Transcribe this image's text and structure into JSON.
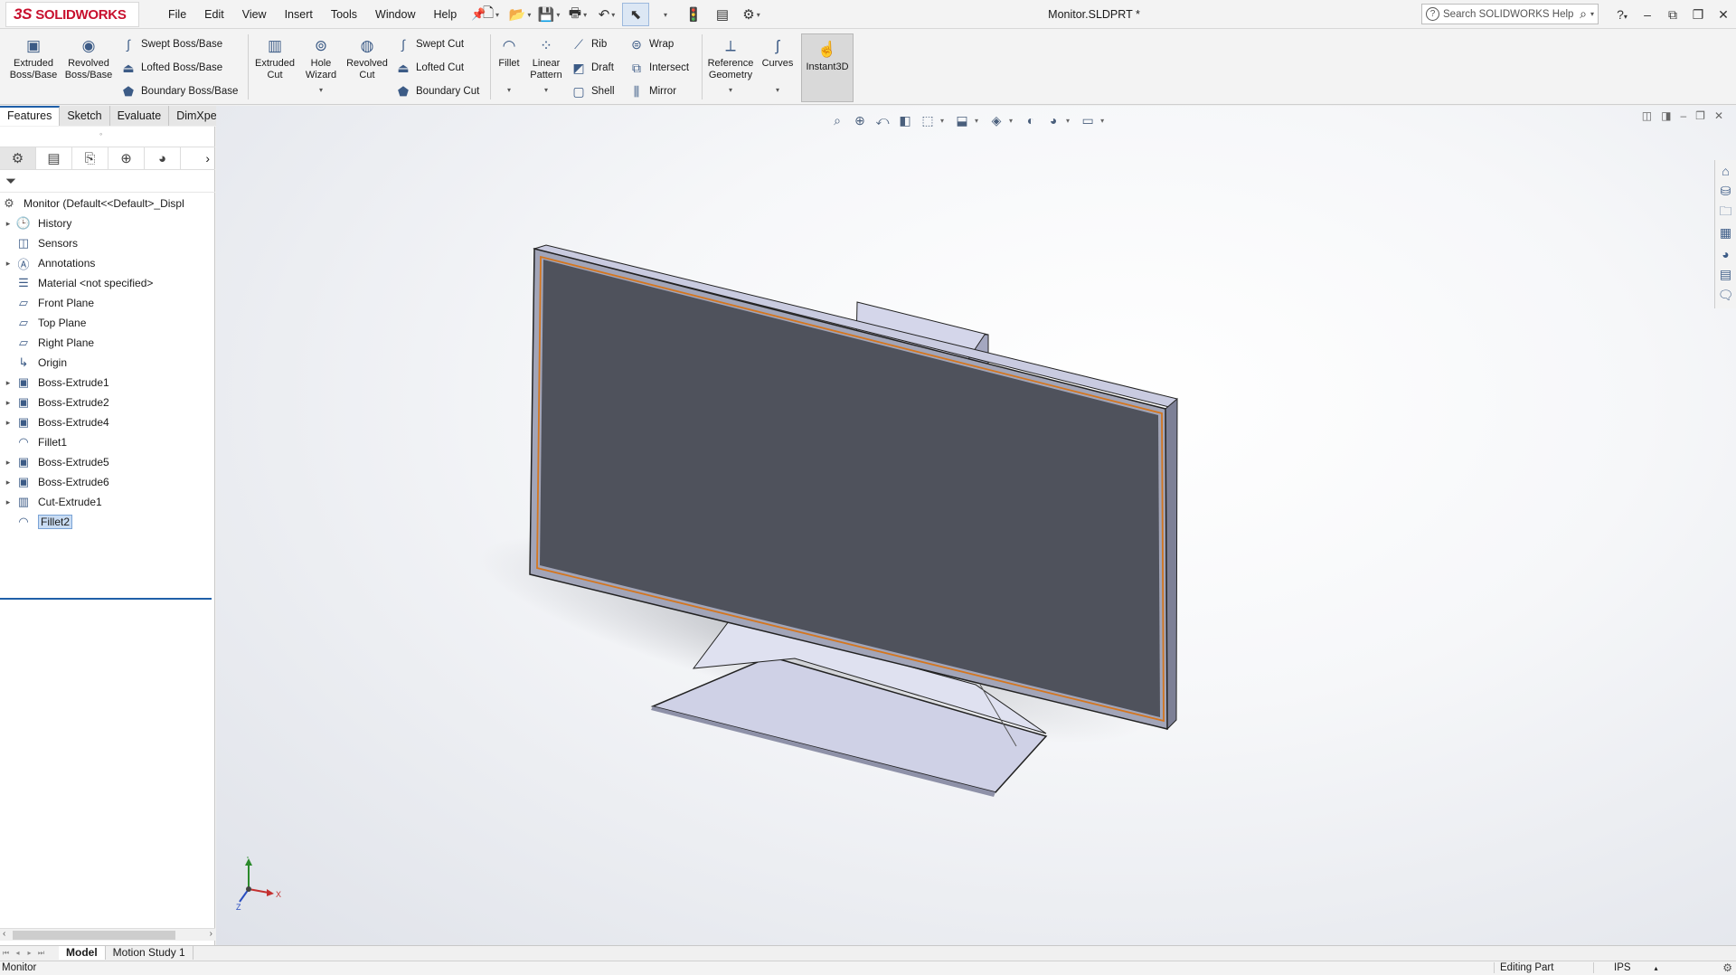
{
  "app": {
    "logo_text": "SOLIDWORKS",
    "logo_mark": "3S",
    "document_title": "Monitor.SLDPRT *",
    "menu": [
      "File",
      "Edit",
      "View",
      "Insert",
      "Tools",
      "Window",
      "Help"
    ],
    "search_placeholder": "Search SOLIDWORKS Help"
  },
  "ribbon": {
    "extruded_boss": "Extruded\nBoss/Base",
    "revolved_boss": "Revolved\nBoss/Base",
    "swept_boss": "Swept Boss/Base",
    "lofted_boss": "Lofted Boss/Base",
    "boundary_boss": "Boundary Boss/Base",
    "extruded_cut": "Extruded\nCut",
    "hole_wizard": "Hole\nWizard",
    "revolved_cut": "Revolved\nCut",
    "swept_cut": "Swept Cut",
    "lofted_cut": "Lofted Cut",
    "boundary_cut": "Boundary Cut",
    "fillet": "Fillet",
    "linear_pattern": "Linear\nPattern",
    "rib": "Rib",
    "draft": "Draft",
    "shell": "Shell",
    "wrap": "Wrap",
    "intersect": "Intersect",
    "mirror": "Mirror",
    "reference_geometry": "Reference\nGeometry",
    "curves": "Curves",
    "instant3d": "Instant3D"
  },
  "command_tabs": [
    "Features",
    "Sketch",
    "Evaluate",
    "DimXpert"
  ],
  "feature_tree": {
    "root": "Monitor  (Default<<Default>_Displ",
    "items": [
      {
        "label": "History",
        "expandable": true,
        "icon": "history-icon"
      },
      {
        "label": "Sensors",
        "expandable": false,
        "icon": "sensors-icon"
      },
      {
        "label": "Annotations",
        "expandable": true,
        "icon": "annotations-icon"
      },
      {
        "label": "Material <not specified>",
        "expandable": false,
        "icon": "material-icon"
      },
      {
        "label": "Front Plane",
        "expandable": false,
        "icon": "plane-icon"
      },
      {
        "label": "Top Plane",
        "expandable": false,
        "icon": "plane-icon"
      },
      {
        "label": "Right Plane",
        "expandable": false,
        "icon": "plane-icon"
      },
      {
        "label": "Origin",
        "expandable": false,
        "icon": "origin-icon"
      },
      {
        "label": "Boss-Extrude1",
        "expandable": true,
        "icon": "extrude-icon"
      },
      {
        "label": "Boss-Extrude2",
        "expandable": true,
        "icon": "extrude-icon"
      },
      {
        "label": "Boss-Extrude4",
        "expandable": true,
        "icon": "extrude-icon"
      },
      {
        "label": "Fillet1",
        "expandable": false,
        "icon": "fillet-icon"
      },
      {
        "label": "Boss-Extrude5",
        "expandable": true,
        "icon": "extrude-icon"
      },
      {
        "label": "Boss-Extrude6",
        "expandable": true,
        "icon": "extrude-icon"
      },
      {
        "label": "Cut-Extrude1",
        "expandable": true,
        "icon": "cut-extrude-icon"
      },
      {
        "label": "Fillet2",
        "expandable": false,
        "icon": "fillet-icon",
        "selected": true
      }
    ]
  },
  "bottom_tabs": [
    "Model",
    "Motion Study 1"
  ],
  "status": {
    "left": "Monitor",
    "mode": "Editing Part",
    "units": "IPS"
  },
  "triad": {
    "x": "X",
    "y": "Y",
    "z": "Z"
  },
  "colors": {
    "brand": "#c8102e",
    "accent": "#1f5fa8",
    "screen_face": "#4f525c",
    "body": "#c9cbe0",
    "edge_highlight": "#d4761f"
  }
}
